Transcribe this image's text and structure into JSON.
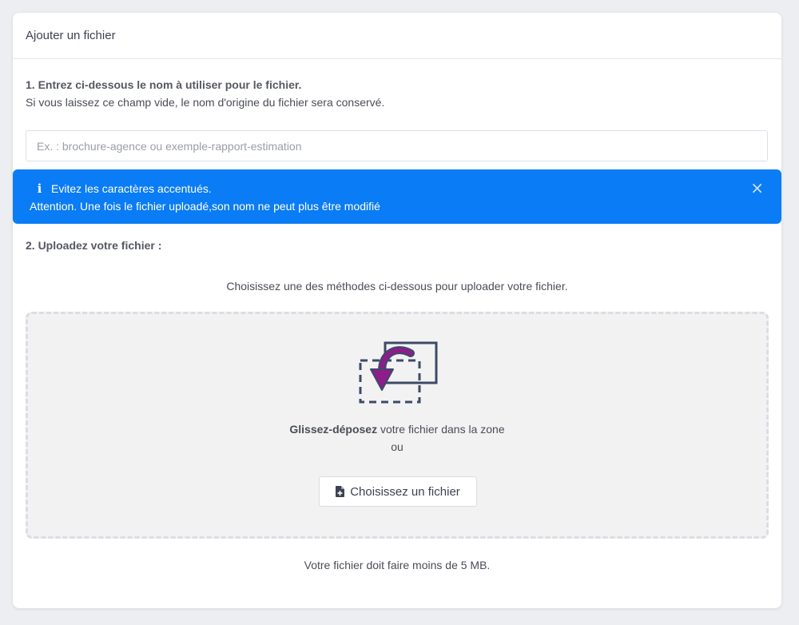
{
  "card": {
    "title": "Ajouter un fichier"
  },
  "step1": {
    "title": "1. Entrez ci-dessous le nom à utiliser pour le fichier.",
    "subtitle": "Si vous laissez ce champ vide, le nom d'origine du fichier sera conservé.",
    "input_value": "",
    "input_placeholder": "Ex. : brochure-agence ou exemple-rapport-estimation"
  },
  "alert": {
    "line1": "Evitez les caractères accentués.",
    "line2": "Attention. Une fois le fichier uploadé,son nom ne peut plus être modifié",
    "close_glyph": "×",
    "info_glyph": "i",
    "color": "#0a7cf5"
  },
  "step2": {
    "title": "2. Uploadez votre fichier :",
    "methods_text": "Choisissez une des méthodes ci-dessous pour uploader votre fichier."
  },
  "dropzone": {
    "bold_text": "Glissez-déposez",
    "rest_text": " votre fichier dans la zone",
    "or_text": "ou",
    "button_label": "Choisissez un fichier",
    "arrow_color": "#8e1c8a",
    "frame_color": "#3d4a66",
    "icon": "drag-drop-icon",
    "button_icon": "file-plus-icon"
  },
  "size_note": "Votre fichier doit faire moins de 5 MB."
}
